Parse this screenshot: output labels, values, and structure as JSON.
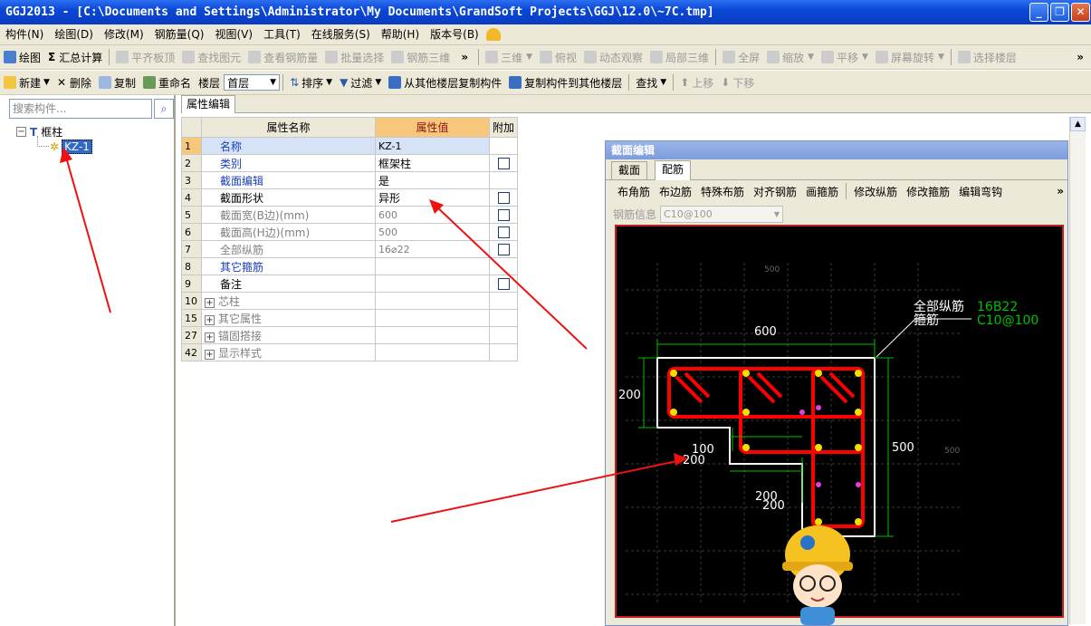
{
  "window": {
    "title": "GGJ2013 - [C:\\Documents and Settings\\Administrator\\My Documents\\GrandSoft Projects\\GGJ\\12.0\\~7C.tmp]"
  },
  "menu": [
    "构件(N)",
    "绘图(D)",
    "修改(M)",
    "钢筋量(Q)",
    "视图(V)",
    "工具(T)",
    "在线服务(S)",
    "帮助(H)",
    "版本号(B)"
  ],
  "toolbar1": {
    "draw": "绘图",
    "sum_calc": "汇总计算",
    "flat_board": "平齐板顶",
    "find_element": "查找图元",
    "view_rebar": "查看钢筋量",
    "batch_select": "批量选择",
    "rebar_3d": "钢筋三维",
    "view_3d": "三维",
    "top_view": "俯视",
    "dynamic_view": "动态观察",
    "local_3d": "局部三维",
    "fullscreen": "全屏",
    "zoom": "缩放",
    "pan": "平移",
    "screen_rotate": "屏幕旋转",
    "select_floor": "选择楼层"
  },
  "toolbar2": {
    "new": "新建",
    "delete": "删除",
    "copy": "复制",
    "rename": "重命名",
    "floor_label": "楼层",
    "floor_value": "首层",
    "sort": "排序",
    "filter": "过滤",
    "copy_from_floor": "从其他楼层复制构件",
    "copy_to_floor": "复制构件到其他楼层",
    "find": "查找",
    "move_up": "上移",
    "move_down": "下移"
  },
  "left": {
    "search_placeholder": "搜索构件...",
    "tree_root": "框柱",
    "tree_child": "KZ-1"
  },
  "prop": {
    "tab": "属性编辑",
    "headers": {
      "name": "属性名称",
      "value": "属性值",
      "extra": "附加"
    },
    "rows": [
      {
        "no": "1",
        "name": "名称",
        "value": "KZ-1"
      },
      {
        "no": "2",
        "name": "类别",
        "value": "框架柱"
      },
      {
        "no": "3",
        "name": "截面编辑",
        "value": "是"
      },
      {
        "no": "4",
        "name": "截面形状",
        "value": "异形"
      },
      {
        "no": "5",
        "name": "截面宽(B边)(mm)",
        "value": "600"
      },
      {
        "no": "6",
        "name": "截面高(H边)(mm)",
        "value": "500"
      },
      {
        "no": "7",
        "name": "全部纵筋",
        "value": "16⌀22"
      },
      {
        "no": "8",
        "name": "其它箍筋",
        "value": ""
      },
      {
        "no": "9",
        "name": "备注",
        "value": ""
      },
      {
        "no": "10",
        "name": "芯柱",
        "value": ""
      },
      {
        "no": "15",
        "name": "其它属性",
        "value": ""
      },
      {
        "no": "27",
        "name": "锚固搭接",
        "value": ""
      },
      {
        "no": "42",
        "name": "显示样式",
        "value": ""
      }
    ]
  },
  "section": {
    "title": "截面编辑",
    "tabs": [
      "截面",
      "配筋"
    ],
    "tools": [
      "布角筋",
      "布边筋",
      "特殊布筋",
      "对齐钢筋",
      "画箍筋",
      "修改纵筋",
      "修改箍筋",
      "编辑弯钩"
    ],
    "rebar_info_label": "钢筋信息",
    "rebar_info_value": "C10@100",
    "canvas": {
      "label_all_rebar": "全部纵筋",
      "label_stirrup": "箍筋",
      "value_all_rebar": "16B22",
      "value_stirrup": "C10@100",
      "dim_600": "600",
      "dim_200_left": "200",
      "dim_500": "500",
      "dim_100": "100",
      "dim_200_mid": "200",
      "dim_200_bottom": "200",
      "dim_200_bottom2": "200",
      "grid_500_top": "500",
      "grid_500_right": "500"
    }
  },
  "colors": {
    "accent": "#f7c87c",
    "title_bar": "#0a48d8",
    "rebar": "#ff0000",
    "dimension": "#00c000",
    "arrow": "#ee1111"
  }
}
